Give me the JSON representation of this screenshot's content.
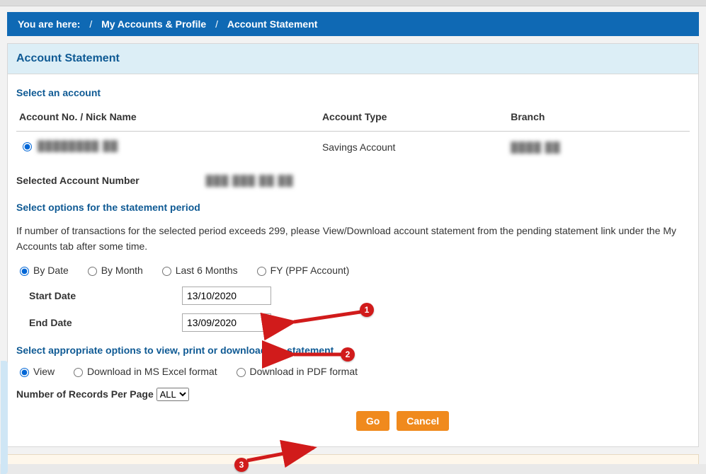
{
  "breadcrumb": {
    "prefix": "You are here:",
    "item1": "My Accounts & Profile",
    "item2": "Account Statement"
  },
  "panel_title": "Account Statement",
  "section1_title": "Select an account",
  "table": {
    "col1": "Account No. / Nick Name",
    "col2": "Account Type",
    "col3": "Branch",
    "row": {
      "acct_masked": "████████  ██",
      "acct_type": "Savings Account",
      "branch_masked": "████   ██"
    }
  },
  "selected_label": "Selected Account Number",
  "selected_value_masked": "███  ███  ██     ██",
  "section2_title": "Select options for the statement period",
  "note": "If number of transactions for the selected period exceeds 299, please View/Download account statement from the pending statement link under the My Accounts tab after some time.",
  "period_options": {
    "by_date": "By Date",
    "by_month": "By Month",
    "last6": "Last 6 Months",
    "fy": "FY (PPF Account)"
  },
  "start_date_label": "Start Date",
  "start_date_value": "13/10/2020",
  "end_date_label": "End Date",
  "end_date_value": "13/09/2020",
  "section3_title": "Select appropriate options to view, print or download the statement",
  "view_options": {
    "view": "View",
    "excel": "Download in MS Excel format",
    "pdf": "Download in PDF format"
  },
  "records_label": "Number of Records Per Page",
  "records_selected": "ALL",
  "buttons": {
    "go": "Go",
    "cancel": "Cancel"
  },
  "annotations": {
    "a1": "1",
    "a2": "2",
    "a3": "3"
  }
}
